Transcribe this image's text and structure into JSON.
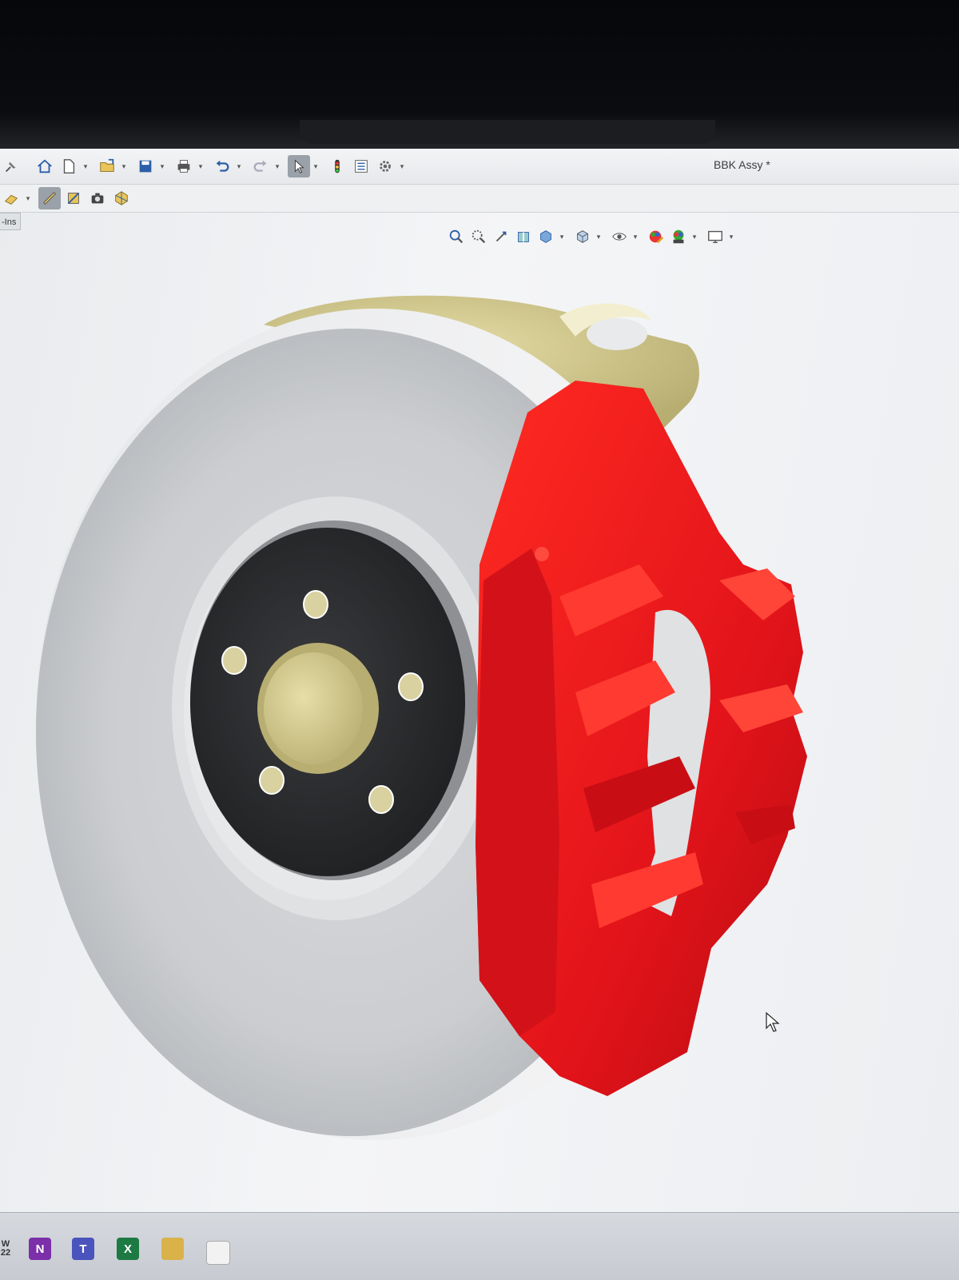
{
  "window": {
    "document_title": "BBK Assy *",
    "tab_stub_label": "-Ins"
  },
  "toolbar": {
    "items": [
      "pin-icon",
      "home-icon",
      "new-document-icon",
      "open-folder-icon",
      "save-icon",
      "print-icon",
      "undo-icon",
      "redo-icon",
      "select-arrow-icon",
      "rebuild-icon",
      "file-properties-icon",
      "options-gear-icon"
    ],
    "row2_items": [
      "display-states-icon",
      "measure-icon",
      "section-view-icon",
      "camera-icon",
      "render-icon"
    ]
  },
  "heads_up_toolbar": {
    "items": [
      "zoom-to-fit-icon",
      "zoom-to-area-icon",
      "previous-view-icon",
      "section-view-icon",
      "view-orientation-icon",
      "display-style-icon",
      "hide-show-icon",
      "edit-appearance-icon",
      "apply-scene-icon",
      "view-settings-icon"
    ]
  },
  "taskbar": {
    "left_label_top": "W",
    "left_label_bottom": "22",
    "onenote_label": "N",
    "teams_label": "T",
    "excel_label": "X"
  },
  "colors": {
    "caliper_red": "#e8141a",
    "rotor_gray": "#c9cbce",
    "knuckle_tan": "#c9c08a",
    "hub_black": "#2a2b2d"
  }
}
